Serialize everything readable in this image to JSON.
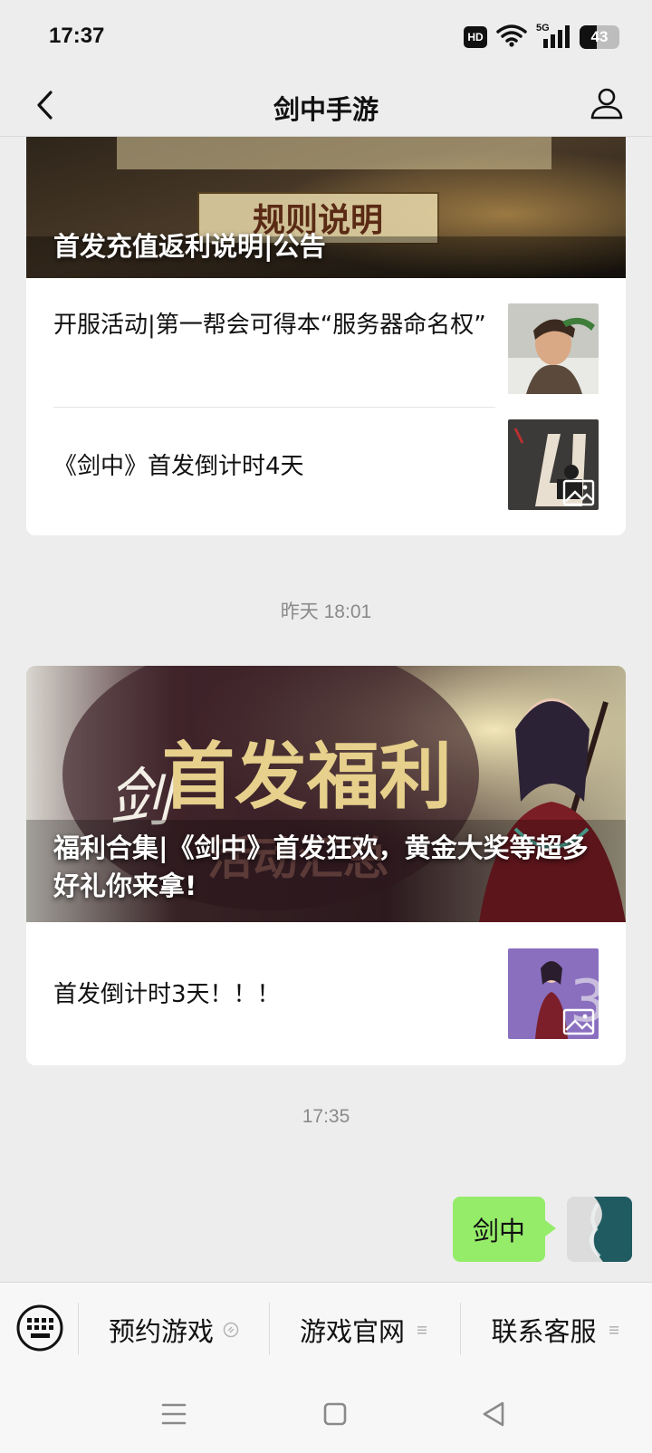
{
  "status_bar": {
    "time": "17:37",
    "hd_label": "HD",
    "network_label": "5G",
    "battery_level": "43"
  },
  "nav": {
    "title": "剑中手游",
    "back_icon": "chevron-left-icon",
    "profile_icon": "user-icon"
  },
  "cards": [
    {
      "cover_title": "首发充值返利说明|公告",
      "cover_overlay_text": "规则说明",
      "articles": [
        {
          "title": "开服活动|第一帮会可得本“服务器命名权”"
        },
        {
          "title": "《剑中》首发倒计时4天"
        }
      ]
    },
    {
      "cover_title": "福利合集|《剑中》首发狂欢，黄金大奖等超多好礼你来拿!",
      "cover_overlay_text": "首发福利",
      "cover_overlay_sub": "活动汇总",
      "cover_overlay_logo": "剑",
      "articles": [
        {
          "title": "首发倒计时3天！！！"
        }
      ]
    }
  ],
  "timestamps": {
    "yesterday": "昨天 18:01",
    "today": "17:35"
  },
  "message": {
    "text": "剑中"
  },
  "menu": {
    "keyboard_icon": "keyboard-icon",
    "items": [
      {
        "label": "预约游戏",
        "icon": "link-icon"
      },
      {
        "label": "游戏官网",
        "icon": "menu-list-icon"
      },
      {
        "label": "联系客服",
        "icon": "menu-list-icon"
      }
    ]
  },
  "colors": {
    "background": "#ededed",
    "bubble": "#95ec69",
    "card": "#ffffff",
    "timestamp": "#8a8a8a"
  }
}
